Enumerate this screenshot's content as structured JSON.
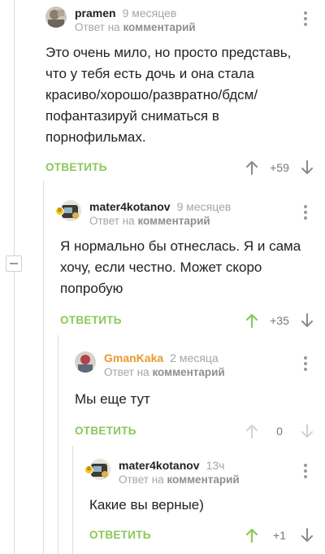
{
  "comments": [
    {
      "author": "pramen",
      "time": "9 месяцев",
      "reply_prefix": "Ответ на",
      "reply_target": "комментарий",
      "text": "Это очень мило, но просто представь, что у тебя есть дочь и она стала красиво/хорошо/развратно/бдсм/пофантазируй сниматься в порнофильмах.",
      "reply_label": "ОТВЕТИТЬ",
      "rating": "+59",
      "upvoted": false
    },
    {
      "author": "mater4kotanov",
      "time": "9 месяцев",
      "reply_prefix": "Ответ на",
      "reply_target": "комментарий",
      "text": "Я нормально бы отнеслась. Я и сама хочу, если честно. Может скоро попробую",
      "reply_label": "ОТВЕТИТЬ",
      "rating": "+35",
      "upvoted": true
    },
    {
      "author": "GmanKaka",
      "time": "2 месяца",
      "reply_prefix": "Ответ на",
      "reply_target": "комментарий",
      "text": "Мы еще тут",
      "reply_label": "ОТВЕТИТЬ",
      "rating": "0",
      "upvoted": false
    },
    {
      "author": "mater4kotanov",
      "time": "13ч",
      "reply_prefix": "Ответ на",
      "reply_target": "комментарий",
      "text": "Какие вы верные)",
      "reply_label": "ОТВЕТИТЬ",
      "rating": "+1",
      "upvoted": true
    }
  ],
  "colors": {
    "accent_green": "#8ac858",
    "username_orange": "#e89a2c",
    "muted_gray": "#a5a5a5"
  },
  "icons": [
    "kebab-menu-icon",
    "upvote-arrow-icon",
    "downvote-arrow-icon",
    "collapse-minus-icon",
    "badge-icon"
  ]
}
